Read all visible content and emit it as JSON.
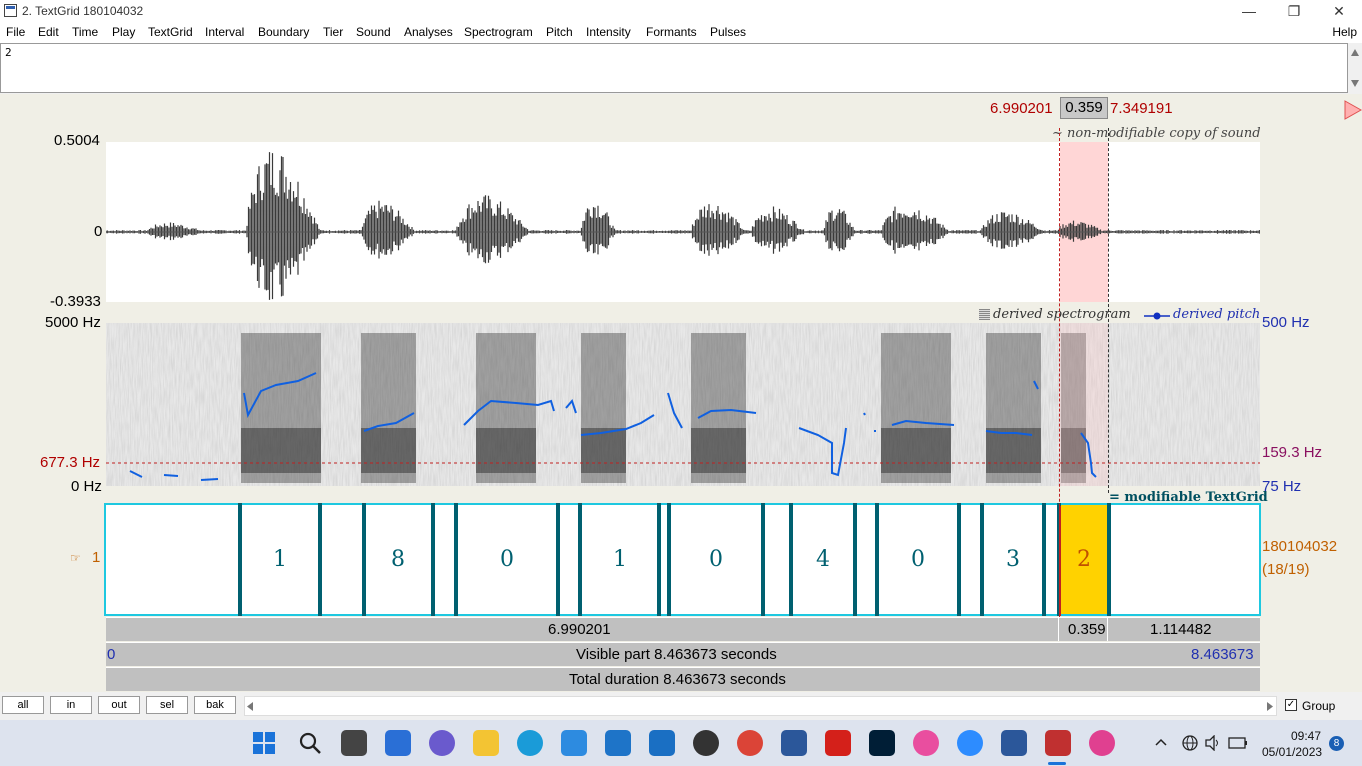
{
  "window": {
    "title": "2. TextGrid 180104032",
    "minimize": "—",
    "maximize": "❐",
    "close": "✕"
  },
  "menu": {
    "items": [
      "File",
      "Edit",
      "Time",
      "Play",
      "TextGrid",
      "Interval",
      "Boundary",
      "Tier",
      "Sound",
      "Analyses",
      "Spectrogram",
      "Pitch",
      "Intensity",
      "Formants",
      "Pulses"
    ],
    "help": "Help"
  },
  "textbox": {
    "value": "2"
  },
  "selection": {
    "start": "6.990201",
    "duration": "0.359",
    "end": "7.349191"
  },
  "sound": {
    "label": "~ non-modifiable copy of sound",
    "ymax": "0.5004",
    "yzero": "0",
    "ymin": "-0.3933"
  },
  "spectrogram": {
    "legend_spec": "derived spectrogram",
    "legend_pitch": "derived pitch",
    "freq_max": "5000 Hz",
    "freq_cursor": "677.3 Hz",
    "freq_min": "0 Hz",
    "pitch_max": "500 Hz",
    "pitch_cursor": "159.3 Hz",
    "pitch_min": "75 Hz"
  },
  "textgrid": {
    "label": "= modifiable TextGrid",
    "tier_number": "1",
    "tier_name": "180104032",
    "tier_count": "(18/19)",
    "intervals": [
      {
        "text": "1"
      },
      {
        "text": "8"
      },
      {
        "text": "0"
      },
      {
        "text": "1"
      },
      {
        "text": "0"
      },
      {
        "text": "4"
      },
      {
        "text": "0"
      },
      {
        "text": "3"
      },
      {
        "text": "2"
      }
    ]
  },
  "bars": {
    "before_selection": "6.990201",
    "selection": "0.359",
    "after_selection": "1.114482",
    "visible_start": "0",
    "visible_label": "Visible part 8.463673 seconds",
    "visible_end": "8.463673",
    "total_label": "Total duration 8.463673 seconds"
  },
  "zoom_buttons": [
    "all",
    "in",
    "out",
    "sel",
    "bak"
  ],
  "group": {
    "label": "Group",
    "checked": "✓"
  },
  "taskbar": {
    "time": "09:47",
    "date": "05/01/2023",
    "notification_count": "8",
    "icons": [
      "start-icon",
      "search-icon",
      "task-view-icon",
      "widgets-icon",
      "teams-chat-icon",
      "file-explorer-icon",
      "edge-icon",
      "store-icon",
      "mail-icon",
      "vscode-icon",
      "media-icon",
      "chrome-icon",
      "word-doc-icon",
      "acrobat-icon",
      "photoshop-icon",
      "music-icon",
      "zoom-icon",
      "word-icon",
      "praat-textgrid-icon",
      "praat-icon"
    ]
  },
  "colors": {
    "selection": "#ffd6d6",
    "textgrid_selected": "#ffd200",
    "pitch": "#1060e0",
    "boundary": "#006070",
    "tier_border": "#1ec8e0"
  }
}
